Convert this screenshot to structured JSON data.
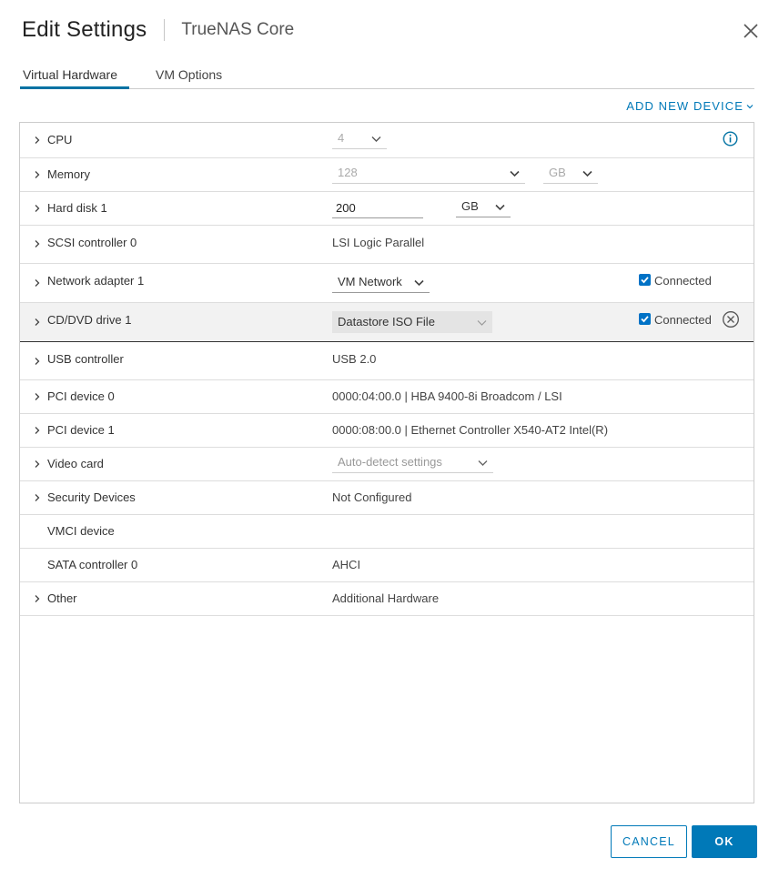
{
  "dialog": {
    "title": "Edit Settings",
    "subtitle": "TrueNAS Core",
    "close_icon": "close-icon"
  },
  "tabs": [
    {
      "label": "Virtual Hardware",
      "active": true
    },
    {
      "label": "VM Options",
      "active": false
    }
  ],
  "add_new_device_label": "ADD NEW DEVICE",
  "hardware": {
    "cpu": {
      "label": "CPU",
      "value": "4"
    },
    "memory": {
      "label": "Memory",
      "value": "128",
      "unit": "GB"
    },
    "hard_disk": {
      "label": "Hard disk 1",
      "value": "200",
      "unit": "GB"
    },
    "scsi": {
      "label": "SCSI controller 0",
      "value": "LSI Logic Parallel"
    },
    "network": {
      "label": "Network adapter 1",
      "value": "VM Network",
      "connected_label": "Connected",
      "connected": true
    },
    "cddvd": {
      "label": "CD/DVD drive 1",
      "value": "Datastore ISO File",
      "connected_label": "Connected",
      "connected": true
    },
    "usb": {
      "label": "USB controller",
      "value": "USB 2.0"
    },
    "pci0": {
      "label": "PCI device 0",
      "value": "0000:04:00.0 | HBA 9400-8i Broadcom / LSI"
    },
    "pci1": {
      "label": "PCI device 1",
      "value": "0000:08:00.0 | Ethernet Controller X540-AT2 Intel(R)"
    },
    "video": {
      "label": "Video card",
      "value": "Auto-detect settings"
    },
    "security": {
      "label": "Security Devices",
      "value": "Not Configured"
    },
    "vmci": {
      "label": "VMCI device",
      "value": ""
    },
    "sata": {
      "label": "SATA controller 0",
      "value": "AHCI"
    },
    "other": {
      "label": "Other",
      "value": "Additional Hardware"
    }
  },
  "buttons": {
    "cancel": "CANCEL",
    "ok": "OK"
  },
  "colors": {
    "accent": "#0079b8",
    "checkbox": "#0072c6",
    "highlight_row": "#f2f2f2"
  }
}
